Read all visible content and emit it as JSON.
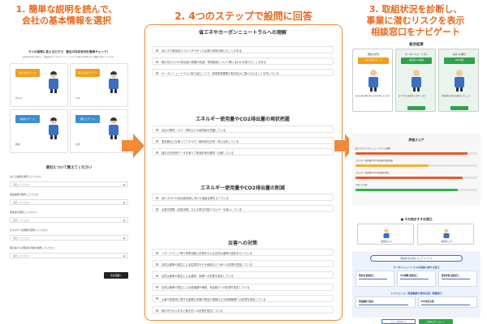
{
  "headings": {
    "step1": [
      "1. 簡単な説明を読んで、",
      "会社の基本情報を選択"
    ],
    "step2": "2. 4つのステップで設問に回答",
    "step3": [
      "3. 取組状況を診断し、",
      "事業に潜むリスクを表示",
      "相談窓口をナビゲート"
    ]
  },
  "panel1": {
    "title": "４つの設問に答えるだけで、貴社の対応状況を簡単チェック！",
    "intro": "国内外の取引先から、脱炭素やカーボンニュートラルへの対応を求められる機会が増えています。",
    "cards": [
      {
        "label": "省エネ",
        "tag": "省エネステージ",
        "color": "#f29f1c"
      },
      {
        "label": "CO2",
        "tag": "見える化ステージ",
        "color": "#f29f1c"
      },
      {
        "label": "削減",
        "tag": "削減ステージ",
        "color": "#3a8fd6"
      },
      {
        "label": "災害",
        "tag": "備えステージ",
        "color": "#3a8fd6"
      }
    ],
    "form_title": "貴社について教えてください",
    "fields": [
      {
        "label": "主たる業種を選択してください",
        "placeholder": "選択してください"
      },
      {
        "label": "従業員数を選択してください",
        "placeholder": "選択してください"
      },
      {
        "label": "資本金を選択してください",
        "placeholder": "選択してください"
      },
      {
        "label": "エネルギー使用量を選択してください",
        "placeholder": "選択してください"
      },
      {
        "label": "取引先からの要請の有無を選択してください",
        "placeholder": "選択してください"
      }
    ],
    "next_button": "次の画面へ"
  },
  "panel2": {
    "sections": [
      {
        "title": "省エネやカーボンニュートラルへの理解",
        "items": [
          "省エネや脱炭素でコストが下がった企業の事例を聞いたことがある",
          "取引先からCO2排出量の把握や削減、環境配慮について問い合わせを受けたことがある",
          "カーボンニュートラルに取り組むことで、新規事業展開や取引拡大に繋げられることを知っている"
        ]
      },
      {
        "title": "エネルギー使用量やCO2排出量の現状把握",
        "items": [
          "自社の電気・ガス・燃料などの使用量を把握している",
          "測定器などを使ってエネルギー使用量を計測・見える化している",
          "過去の光熱費データを使って削減余地を確認・比較している"
        ]
      },
      {
        "title": "エネルギー使用量やCO2排出量の削減",
        "items": [
          "省エネやCO2排出量削減に向けた取組目標を立てている",
          "太陽光発電（自家消費）などの再生可能エネルギーを導入している"
        ]
      },
      {
        "title": "災害への対策",
        "items": [
          "ハザードマップ等で事業活動に影響を与える自然災害等の想定を行っている",
          "自然災害等の発生による従業員やその家族など人命への影響を想定している",
          "自然災害等の発生による建物・設備への影響を想定している",
          "自然災害等の発生による被害額や補償、資金繰りへの影響を想定している",
          "災害や緊急時に関する重要な情報の発信や連絡などの情報管理への影響を想定している",
          "取引先や仕入先など取引先への影響を想定している"
        ]
      }
    ]
  },
  "panel3": {
    "result_title": "総合結果",
    "result_cards": [
      {
        "title": "貴社の状況",
        "tag": "見える化ステージ",
        "text": "自社の排出量の見える化が進んでいます"
      },
      {
        "title": "カーボンニュートラル",
        "tag": "脱炭素への取組",
        "text": "おすすめの取組をご紹介します"
      },
      {
        "title": "災害への備え",
        "tag": "BCP対策",
        "text": "事業継続の備えを確認しましょう"
      }
    ],
    "score_title": "評価スコア",
    "scores": [
      {
        "label": "省エネやカーボンニュートラルへの理解",
        "value": 0.92,
        "color": "#e35b2c"
      },
      {
        "label": "エネルギー使用量やCO2排出量の現状把握",
        "value": 0.6,
        "color": "#f2b233"
      },
      {
        "label": "エネルギー使用量やCO2排出量の削減",
        "value": 0.88,
        "color": "#e35b2c"
      },
      {
        "label": "災害への対策",
        "value": 0.84,
        "color": "#2fb24c"
      }
    ],
    "consult_title": "その他おすすめ窓口",
    "consult_cards": [
      "相談窓口 A",
      "相談窓口 B"
    ],
    "banner": "取組状況を踏まえたアドバイス",
    "advice_title": "カーボンニュートラルの取組に関する窓口",
    "advice_cards": [
      "環境省 相談窓口",
      "中小機構 相談窓口",
      "都道府県 相談窓口"
    ],
    "advice_title2": "レジリエンス（事業継続力強化計画）関連窓口",
    "advice_cards2": [
      "事業継続力強化",
      "BCP策定支援"
    ],
    "buttons": [
      "もう一度診断する",
      "結果をダウンロード"
    ]
  }
}
